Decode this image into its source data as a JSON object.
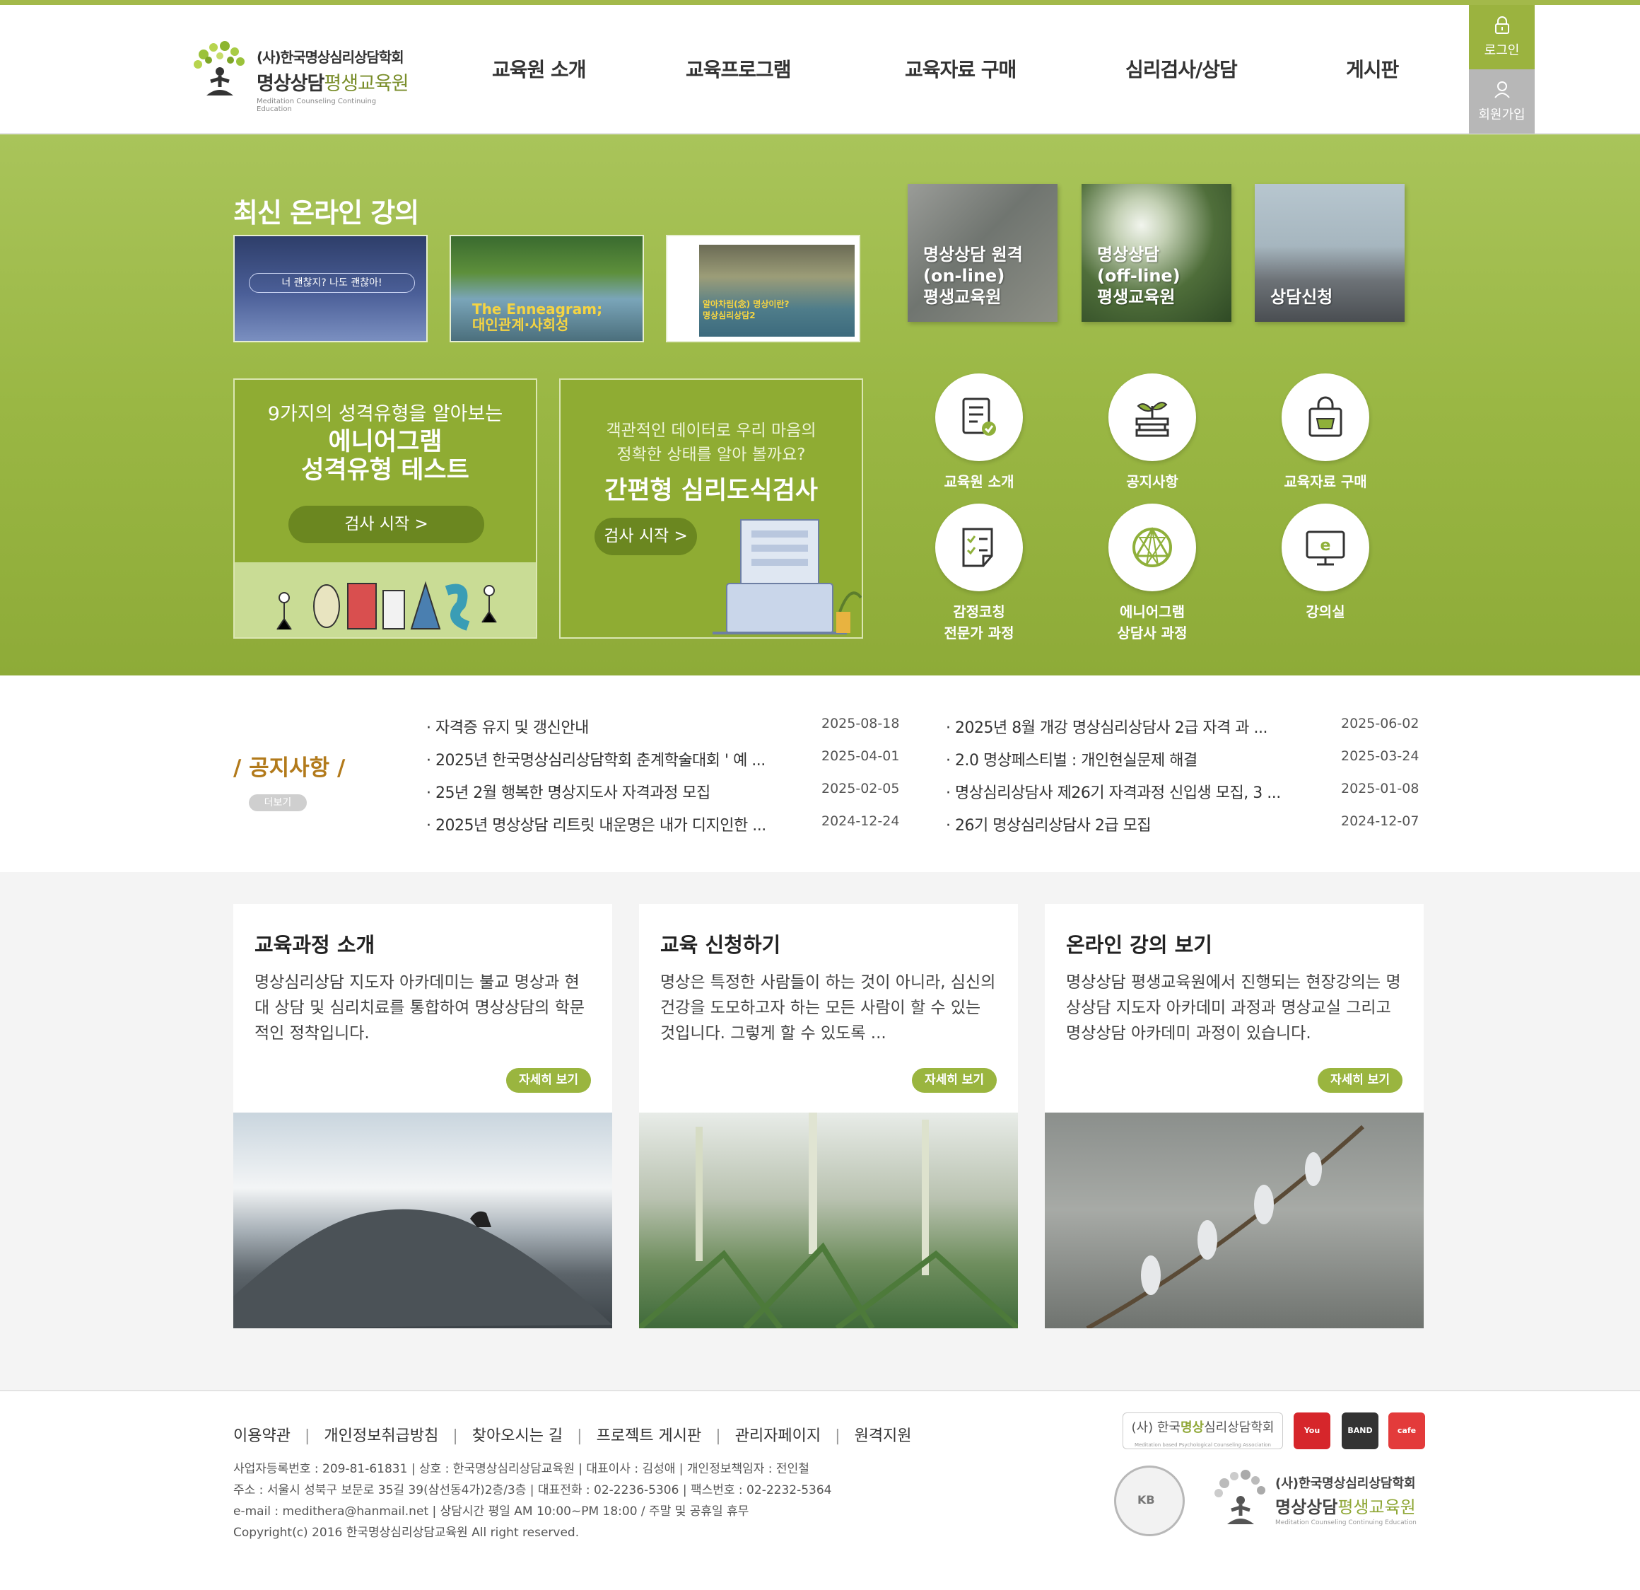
{
  "header": {
    "logo_line1": "(사)한국명상심리상담학회",
    "logo_line2a": "명상상담",
    "logo_line2b": "평생교육원",
    "logo_line3": "Meditation Counseling Continuing Education",
    "nav": [
      "교육원 소개",
      "교육프로그램",
      "교육자료 구매",
      "심리검사/상담",
      "게시판"
    ],
    "login": "로그인",
    "join": "회원가입",
    "accent_color": "#9bb33f"
  },
  "hero": {
    "title": "최신 온라인 강의",
    "thumbs": [
      {
        "text": "너 괜찮지? 나도 괜찮아!"
      },
      {
        "text1": "The Enneagram;",
        "text2": "대인관계·사회성"
      },
      {
        "text1": "알아차림(念) 명상이란?",
        "text2": "명상심리상담2"
      }
    ],
    "photo_cards": [
      {
        "line1": "명상상담 원격",
        "line2": "(on-line)",
        "line3": "평생교육원"
      },
      {
        "line1": "명상상담",
        "line2": "(off-line)",
        "line3": "평생교육원"
      },
      {
        "line1": "상담신청"
      }
    ],
    "banner1": {
      "sub": "9가지의 성격유형을 알아보는",
      "title1": "에니어그램",
      "title2": "성격유형 테스트",
      "button": "검사 시작 >"
    },
    "banner2": {
      "sub1": "객관적인 데이터로 우리 마음의",
      "sub2": "정확한 상태를 알아 볼까요?",
      "title": "간편형 심리도식검사",
      "button": "검사 시작 >"
    },
    "quick": [
      {
        "label1": "교육원 소개",
        "label2": "",
        "icon": "document-check-icon"
      },
      {
        "label1": "공지사항",
        "label2": "",
        "icon": "sprout-book-icon"
      },
      {
        "label1": "교육자료 구매",
        "label2": "",
        "icon": "shopping-bag-icon"
      },
      {
        "label1": "감정코칭",
        "label2": "전문가 과정",
        "icon": "checklist-icon"
      },
      {
        "label1": "에니어그램",
        "label2": "상담사 과정",
        "icon": "enneagram-icon"
      },
      {
        "label1": "강의실",
        "label2": "",
        "icon": "e-learning-monitor-icon"
      }
    ]
  },
  "notice": {
    "title": "/ 공지사항 /",
    "more": "더보기",
    "left": [
      {
        "text": "· 자격증 유지 및 갱신안내",
        "date": "2025-08-18"
      },
      {
        "text": "· 2025년 한국명상심리상담학회 춘계학술대회 ' 예 ...",
        "date": "2025-04-01"
      },
      {
        "text": "· 25년 2월 행복한 명상지도사 자격과정 모집",
        "date": "2025-02-05"
      },
      {
        "text": "· 2025년 명상상담 리트릿 내운명은 내가 디지인한 ...",
        "date": "2024-12-24"
      }
    ],
    "right": [
      {
        "text": "· 2025년 8월 개강 명상심리상담사 2급 자격 과 ...",
        "date": "2025-06-02"
      },
      {
        "text": "· 2.0 명상페스티벌 : 개인현실문제 해결",
        "date": "2025-03-24"
      },
      {
        "text": "· 명상심리상담사 제26기 자격과정 신입생 모집, 3 ...",
        "date": "2025-01-08"
      },
      {
        "text": "· 26기 명상심리상담사 2급 모집",
        "date": "2024-12-07"
      }
    ]
  },
  "courses": [
    {
      "title": "교육과정 소개",
      "desc": "명상심리상담 지도자 아카데미는 불교 명상과 현대 상담 및 심리치료를 통합하여 명상상담의 학문적인 정착입니다.",
      "button": "자세히 보기"
    },
    {
      "title": "교육 신청하기",
      "desc": "명상은 특정한 사람들이 하는 것이 아니라, 심신의 건강을 도모하고자 하는 모든 사람이 할 수 있는 것입니다. 그렇게 할 수 있도록 ...",
      "button": "자세히 보기"
    },
    {
      "title": "온라인 강의 보기",
      "desc": "명상상담 평생교육원에서 진행되는 현장강의는 명상상담 지도자 아카데미 과정과 명상교실 그리고 명상상담 아카데미 과정이 있습니다.",
      "button": "자세히 보기"
    }
  ],
  "footer": {
    "links": [
      "이용약관",
      "개인정보취급방침",
      "찾아오시는 길",
      "프로젝트 게시판",
      "관리자페이지",
      "원격지원"
    ],
    "info": [
      "사업자등록번호 : 209-81-61831   |   상호 : 한국명상심리상담교육원   |   대표이사 : 김성애   |   개인정보책임자 : 전인철",
      "주소 : 서울시 성북구 보문로 35길 39(삼선동4가)2층/3층   |   대표전화 : 02-2236-5306   |   팩스번호 : 02-2232-5364",
      "e-mail : medithera@hanmail.net   |   상담시간 평일 AM 10:00~PM 18:00 / 주말 및 공휴일 휴무",
      "Copyright(c) 2016 한국명상심리상담교육원 All right reserved."
    ],
    "assoc_a": "(사) 한국",
    "assoc_b": "명상",
    "assoc_c": "심리상담학회",
    "assoc_small": "Meditation based Psychological Counseling Association",
    "sns": [
      "You Tube",
      "BAND",
      "cafe"
    ],
    "seal": "KB",
    "logo_line1": "(사)한국명상심리상담학회",
    "logo_line2a": "명상상담",
    "logo_line2b": "평생교육원",
    "logo_line3": "Meditation Counseling Continuing Education"
  }
}
